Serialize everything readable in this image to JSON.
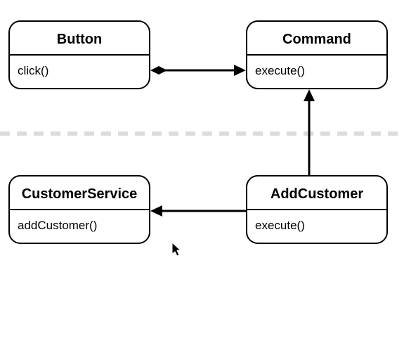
{
  "classes": {
    "button": {
      "name": "Button",
      "method": "click()"
    },
    "command": {
      "name": "Command",
      "method": "execute()"
    },
    "customerService": {
      "name": "CustomerService",
      "method": "addCustomer()"
    },
    "addCustomer": {
      "name": "AddCustomer",
      "method": "execute()"
    }
  },
  "relations": [
    {
      "from": "Button",
      "to": "Command",
      "type": "association-solid-diamond"
    },
    {
      "from": "AddCustomer",
      "to": "Command",
      "type": "generalization"
    },
    {
      "from": "AddCustomer",
      "to": "CustomerService",
      "type": "association"
    }
  ]
}
